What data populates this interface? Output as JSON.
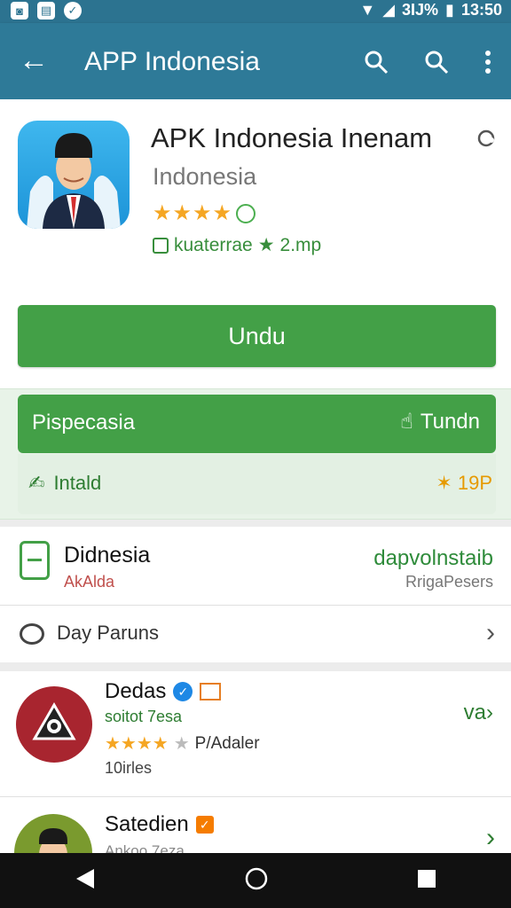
{
  "status_bar": {
    "battery_text": "3IJ%",
    "time": "13:50"
  },
  "app_bar": {
    "title": "APP Indonesia"
  },
  "app": {
    "name": "APK Indonesia Inenam",
    "developer": "Indonesia",
    "stars": "★★★★",
    "meta_text": "kuaterrae",
    "size_text": "2.mp"
  },
  "install_button": {
    "label": "Undu"
  },
  "green_panel": {
    "bar_left": "Pispecasia",
    "bar_right": "Tundn",
    "row_left": "Intald",
    "row_right": "19P"
  },
  "info_card": {
    "title": "Didnesia",
    "subtitle": "AkAlda",
    "right_title": "dapvolnstaib",
    "right_sub": "RrigaPesers"
  },
  "review_row": {
    "label": "Day Paruns"
  },
  "list": [
    {
      "title": "Dedas",
      "subtitle": "soitot 7esa",
      "stars": "★★★★",
      "rating_label": "P/Adaler",
      "version": "10irles",
      "right": "va"
    },
    {
      "title": "Satedien",
      "subtitle": "Ankoo 7eza"
    }
  ]
}
